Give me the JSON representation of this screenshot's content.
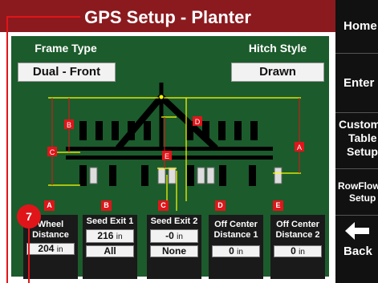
{
  "header": {
    "title": "GPS Setup - Planter"
  },
  "frame_type": {
    "label": "Frame Type",
    "value": "Dual - Front"
  },
  "hitch_style": {
    "label": "Hitch Style",
    "value": "Drawn"
  },
  "diagram": {
    "labels": [
      "A",
      "B",
      "C",
      "D",
      "E"
    ]
  },
  "bottom_tags": [
    "A",
    "B",
    "C",
    "D",
    "E"
  ],
  "bottom_fields": [
    {
      "title_line1": "Wheel",
      "title_line2": "Distance",
      "value": "204",
      "unit": "in"
    },
    {
      "title_line1": "Seed Exit 1",
      "value": "216",
      "unit": "in",
      "sub_value": "All"
    },
    {
      "title_line1": "Seed Exit 2",
      "value": "-0",
      "unit": "in",
      "sub_value": "None"
    },
    {
      "title_line1": "Off Center",
      "title_line2": "Distance 1",
      "value": "0",
      "unit": "in"
    },
    {
      "title_line1": "Off Center",
      "title_line2": "Distance 2",
      "value": "0",
      "unit": "in"
    }
  ],
  "callout_badge": "7",
  "sidebar": {
    "home": "Home",
    "enter": "Enter",
    "custom_line1": "Custom",
    "custom_line2": "Table",
    "custom_line3": "Setup",
    "rowflow_line1": "RowFlow",
    "rowflow_line2": "Setup",
    "back": "Back"
  },
  "colors": {
    "title_bar": "#8b1a1f",
    "panel": "#1c5b2c",
    "callout": "#e0151a",
    "measure_line": "#ffff00"
  }
}
